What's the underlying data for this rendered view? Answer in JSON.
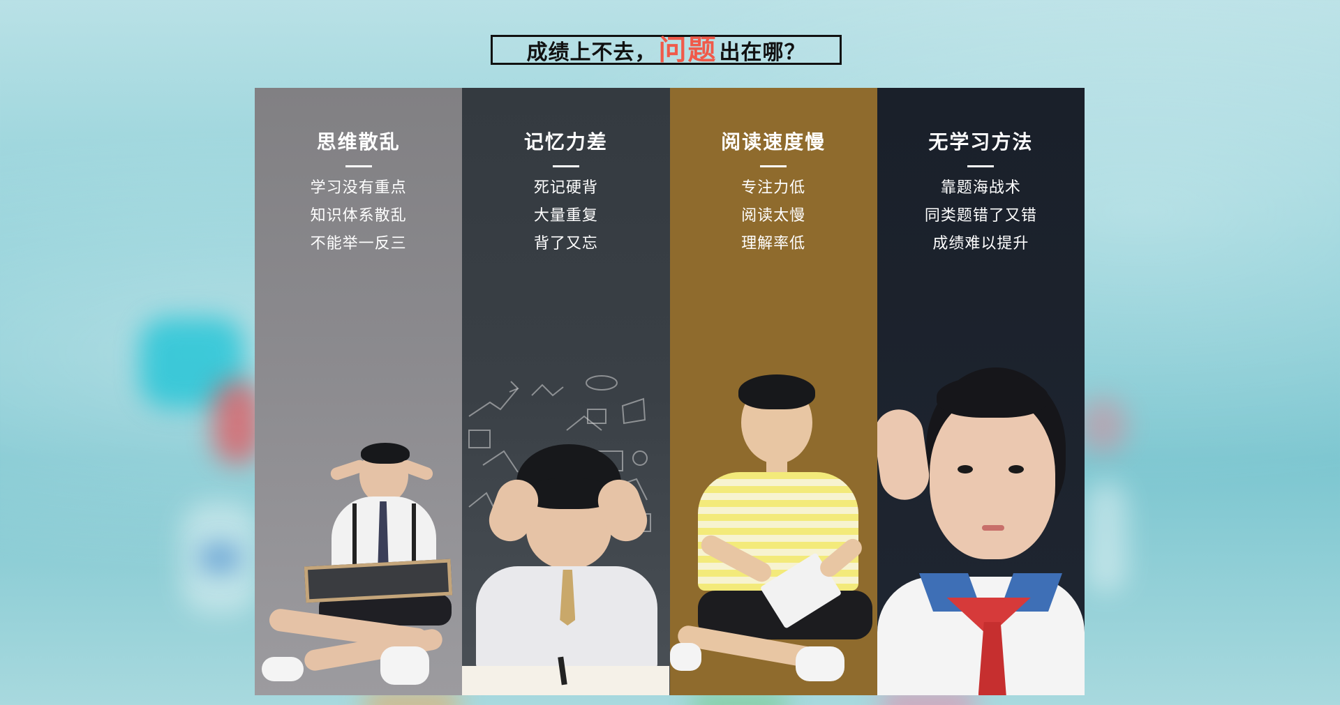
{
  "heading": {
    "prefix": "成绩上不去，",
    "accent": "问题",
    "suffix": "出在哪？"
  },
  "panels": [
    {
      "title": "思维散乱",
      "lines": [
        "学习没有重点",
        "知识体系散乱",
        "不能举一反三"
      ]
    },
    {
      "title": "记忆力差",
      "lines": [
        "死记硬背",
        "大量重复",
        "背了又忘"
      ]
    },
    {
      "title": "阅读速度慢",
      "lines": [
        "专注力低",
        "阅读太慢",
        "理解率低"
      ]
    },
    {
      "title": "无学习方法",
      "lines": [
        "靠题海战术",
        "同类题错了又错",
        "成绩难以提升"
      ]
    }
  ],
  "colors": {
    "accent": "#f05a4a",
    "panel1": "#8a898d",
    "panel2": "#3a4046",
    "panel3": "#8f6b2d",
    "panel4": "#1f2631"
  }
}
